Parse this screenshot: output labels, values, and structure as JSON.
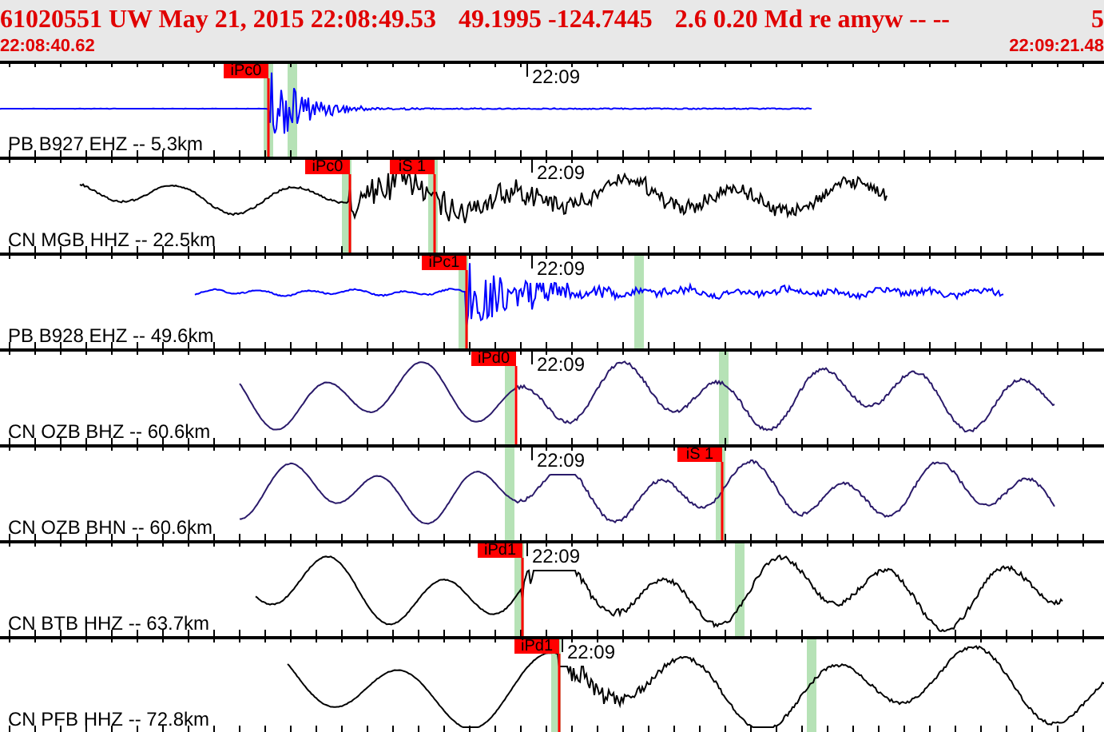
{
  "header": {
    "fields": [
      "61020551 UW May 21, 2015 22:08:49.53",
      "49.1995 -124.7445",
      "2.6 0.20 Md re amyw -- --",
      "5"
    ],
    "start_time": "22:08:40.62",
    "end_time": "22:09:21.48"
  },
  "traces": [
    {
      "label": "PB B927 EHZ -- 5.3km",
      "time_mark": "22:09",
      "color": "#0000ff",
      "picks": [
        {
          "label": "iPc0"
        }
      ]
    },
    {
      "label": "CN MGB HHZ -- 22.5km",
      "time_mark": "22:09",
      "color": "#000000",
      "picks": [
        {
          "label": "iPc0"
        },
        {
          "label": "iS 1"
        }
      ]
    },
    {
      "label": "PB B928 EHZ -- 49.6km",
      "time_mark": "22:09",
      "color": "#0000ff",
      "picks": [
        {
          "label": "iPc1"
        }
      ]
    },
    {
      "label": "CN OZB BHZ -- 60.6km",
      "time_mark": "22:09",
      "color": "#2a1a6a",
      "picks": [
        {
          "label": "iPd0"
        }
      ]
    },
    {
      "label": "CN OZB BHN -- 60.6km",
      "time_mark": "22:09",
      "color": "#2a1a6a",
      "picks": [
        {
          "label": "iS 1"
        }
      ]
    },
    {
      "label": "CN BTB HHZ -- 63.7km",
      "time_mark": "22:09",
      "color": "#000000",
      "picks": [
        {
          "label": "iPd1"
        }
      ]
    },
    {
      "label": "CN PFB HHZ -- 72.8km",
      "time_mark": "22:09",
      "color": "#000000",
      "picks": [
        {
          "label": "iPd1"
        }
      ]
    }
  ]
}
